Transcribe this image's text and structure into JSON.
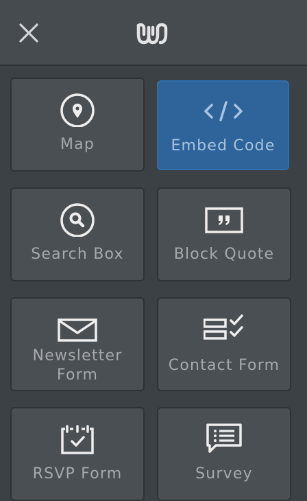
{
  "header": {
    "close_icon": "close-icon",
    "logo_icon": "weebly-logo-icon"
  },
  "colors": {
    "background": "#3c4145",
    "header": "#464b4f",
    "tile": "#4a4f53",
    "tile_active": "#2e6499",
    "label": "#a5a9ac",
    "icon": "#eeeeee"
  },
  "elements": [
    {
      "label": "Map",
      "icon": "map-pin-icon",
      "active": false
    },
    {
      "label": "Embed Code",
      "icon": "code-icon",
      "active": true
    },
    {
      "label": "Search Box",
      "icon": "search-icon",
      "active": false
    },
    {
      "label": "Block Quote",
      "icon": "quote-icon",
      "active": false
    },
    {
      "label": "Newsletter Form",
      "icon": "envelope-icon",
      "active": false
    },
    {
      "label": "Contact Form",
      "icon": "contact-form-icon",
      "active": false
    },
    {
      "label": "RSVP Form",
      "icon": "rsvp-calendar-icon",
      "active": false
    },
    {
      "label": "Survey",
      "icon": "survey-chat-icon",
      "active": false
    }
  ]
}
